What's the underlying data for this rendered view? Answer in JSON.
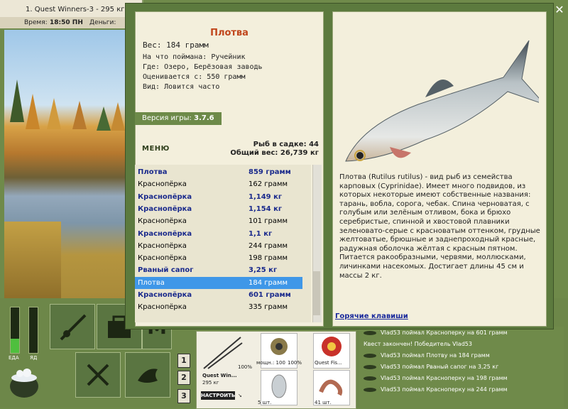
{
  "game": {
    "title": "1. Quest Winners-3 - 295 кг",
    "time_label": "Время:",
    "time_value": "18:50 ПН",
    "money_label": "Деньги:"
  },
  "gauges": {
    "left_label": "ЕДА",
    "right_label": "ЯД"
  },
  "number_buttons": [
    "1",
    "2",
    "3"
  ],
  "gear": {
    "rod_name": "Quest Win...",
    "rod_weight": "295 кг",
    "percent_top": "100%",
    "percent_bottom": "100%",
    "reel_label": "мощн.: 100",
    "reel_percent": "100%",
    "line_label": "Quest Fis...",
    "lure_count": "5 шт.",
    "bait_count": "41 шт.",
    "setup_button": "НАСТРОИТЬ"
  },
  "chat_log": [
    "Vlad53 поймал Красноперку на 601 грамм",
    "Квест закончен! Победитель Vlad53",
    "Vlad53 поймал Плотву на 184 грамм",
    "Vlad53 поймал Рваный сапог на 3,25 кг",
    "Vlad53 поймал Красноперку на 198 грамм",
    "Vlad53 поймал Красноперку на 244 грамм"
  ],
  "dialog": {
    "close_glyph": "✕",
    "fish": {
      "name": "Плотва",
      "weight": "Вес: 184 грамм",
      "caught_on": "На что поймана: Ручейник",
      "where": "Где: Озеро, Берёзовая заводь",
      "value": "Оценивается с: 550 грамм",
      "frequency": "Вид: Ловится часто"
    },
    "version_label": "Версия игры:",
    "version_value": "3.7.6",
    "menu_button": "МЕНЮ",
    "keepnet_count": "Рыб в садке: 44",
    "total_weight": "Общий вес: 26,739 кг",
    "catch_list": [
      {
        "name": "Плотва",
        "weight": "859 грамм",
        "bold": true
      },
      {
        "name": "Краснопёрка",
        "weight": "162 грамм",
        "bold": false
      },
      {
        "name": "Краснопёрка",
        "weight": "1,149 кг",
        "bold": true
      },
      {
        "name": "Краснопёрка",
        "weight": "1,154 кг",
        "bold": true
      },
      {
        "name": "Краснопёрка",
        "weight": "101 грамм",
        "bold": false
      },
      {
        "name": "Краснопёрка",
        "weight": "1,1 кг",
        "bold": true
      },
      {
        "name": "Краснопёрка",
        "weight": "244 грамм",
        "bold": false
      },
      {
        "name": "Краснопёрка",
        "weight": "198 грамм",
        "bold": false
      },
      {
        "name": "Рваный сапог",
        "weight": "3,25 кг",
        "bold": true
      },
      {
        "name": "Плотва",
        "weight": "184 грамм",
        "bold": false,
        "selected": true
      },
      {
        "name": "Краснопёрка",
        "weight": "601 грамм",
        "bold": true
      },
      {
        "name": "Краснопёрка",
        "weight": "335 грамм",
        "bold": false
      }
    ],
    "description": "Плотва (Rutilus rutilus) - вид рыб из семейства карповых (Cyprinidae). Имеет много подвидов, из которых некоторые имеют собственные названия: тарань, вобла, сорога, чебак. Спина черноватая, с голубым или зелёным отливом, бока и брюхо серебристые, спинной и хвостовой плавники зеленовато-серые с красноватым оттенком, грудные желтоватые, брюшные и заднепроходный красные, радужная оболочка жёлтая с красным пятном. Питается ракообразными, червями, моллюсками, личинками насекомых. Достигает длины 45 см и массы 2 кг.",
    "hotkeys_link": "Горячие клавиши"
  },
  "colors": {
    "accent": "#c0461c",
    "link": "#1a2a9c",
    "selection": "#3f97e8",
    "panel": "#f3efdc",
    "frame": "#5c7a3e"
  }
}
